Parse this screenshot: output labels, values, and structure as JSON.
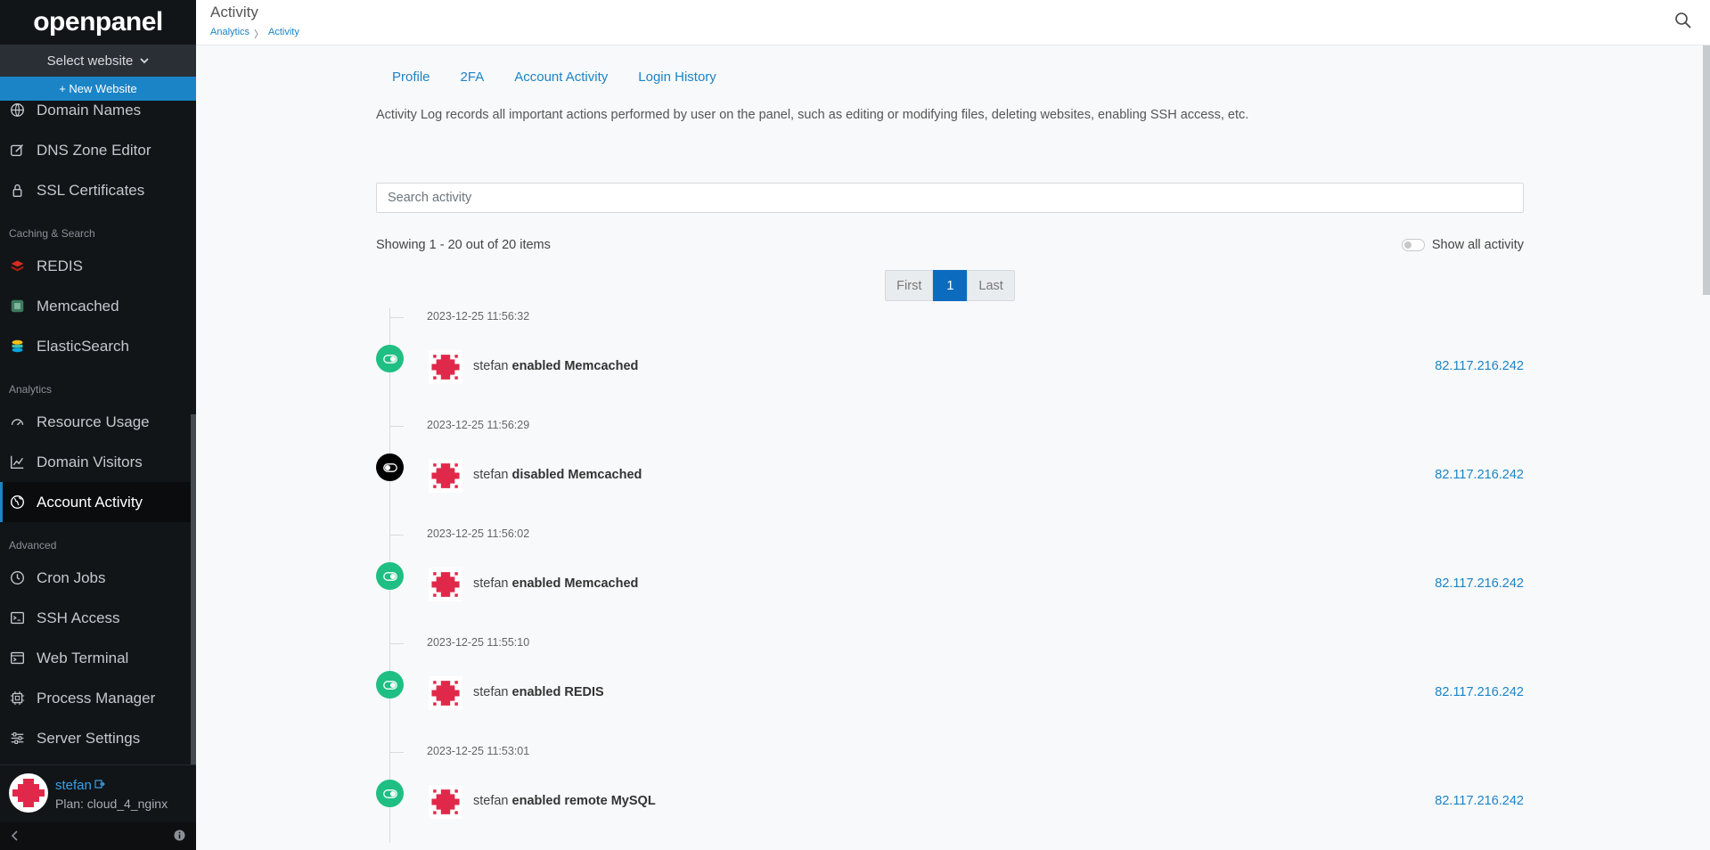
{
  "brand": "openpanel",
  "sidebar": {
    "select_website": "Select website",
    "new_website": "+ New Website",
    "items_top": [
      {
        "label": "Domain Names",
        "icon": "globe-icon"
      },
      {
        "label": "DNS Zone Editor",
        "icon": "edit-icon"
      },
      {
        "label": "SSL Certificates",
        "icon": "lock-icon"
      }
    ],
    "cat_caching": "Caching & Search",
    "items_caching": [
      {
        "label": "REDIS",
        "icon": "redis-icon"
      },
      {
        "label": "Memcached",
        "icon": "memcached-icon"
      },
      {
        "label": "ElasticSearch",
        "icon": "elasticsearch-icon"
      }
    ],
    "cat_analytics": "Analytics",
    "items_analytics": [
      {
        "label": "Resource Usage",
        "icon": "gauge-icon"
      },
      {
        "label": "Domain Visitors",
        "icon": "chart-line-icon"
      },
      {
        "label": "Account Activity",
        "icon": "globe-icon",
        "active": true
      }
    ],
    "cat_advanced": "Advanced",
    "items_advanced": [
      {
        "label": "Cron Jobs",
        "icon": "clock-icon"
      },
      {
        "label": "SSH Access",
        "icon": "terminal-icon"
      },
      {
        "label": "Web Terminal",
        "icon": "window-terminal-icon"
      },
      {
        "label": "Process Manager",
        "icon": "cpu-icon"
      },
      {
        "label": "Server Settings",
        "icon": "sliders-icon"
      }
    ],
    "user": {
      "name": "stefan",
      "plan": "Plan: cloud_4_nginx"
    }
  },
  "header": {
    "title": "Activity",
    "breadcrumb": [
      "Analytics",
      "〉",
      "Activity"
    ]
  },
  "tabs": [
    "Profile",
    "2FA",
    "Account Activity",
    "Login History"
  ],
  "intro": "Activity Log records all important actions performed by user on the panel, such as editing or modifying files, deleting websites, enabling SSH access, etc.",
  "search": {
    "placeholder": "Search activity"
  },
  "showing": "Showing 1 - 20 out of 20 items",
  "show_all_label": "Show all activity",
  "pagination": {
    "first": "First",
    "current": "1",
    "last": "Last"
  },
  "entries": [
    {
      "timestamp": "2023-12-25 11:56:32",
      "user": "stefan",
      "action": "enabled Memcached",
      "ip": "82.117.216.242",
      "status": "enabled"
    },
    {
      "timestamp": "2023-12-25 11:56:29",
      "user": "stefan",
      "action": "disabled Memcached",
      "ip": "82.117.216.242",
      "status": "disabled"
    },
    {
      "timestamp": "2023-12-25 11:56:02",
      "user": "stefan",
      "action": "enabled Memcached",
      "ip": "82.117.216.242",
      "status": "enabled"
    },
    {
      "timestamp": "2023-12-25 11:55:10",
      "user": "stefan",
      "action": "enabled REDIS",
      "ip": "82.117.216.242",
      "status": "enabled"
    },
    {
      "timestamp": "2023-12-25 11:53:01",
      "user": "stefan",
      "action": "enabled remote MySQL",
      "ip": "82.117.216.242",
      "status": "enabled"
    }
  ],
  "colors": {
    "accent": "#1b84c6",
    "enabled": "#1fbf83",
    "disabled": "#000000",
    "avatar": "#e0294a"
  }
}
